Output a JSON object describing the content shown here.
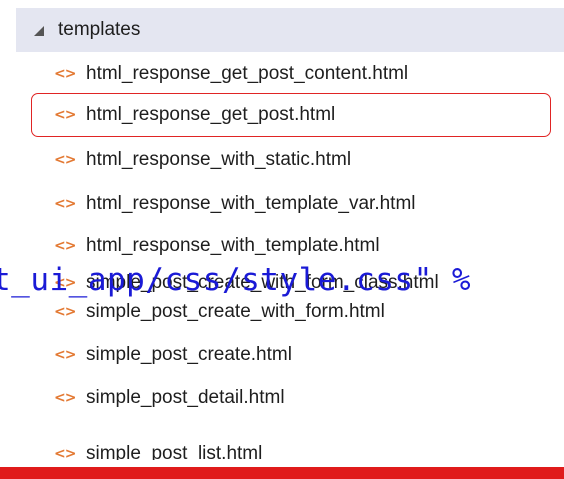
{
  "explorer": {
    "folder": {
      "label": "templates",
      "icon": "expanded-triangle-icon"
    },
    "file_icon_glyph": "<>",
    "files": [
      {
        "label": "html_response_get_post_content.html"
      },
      {
        "label": "html_response_get_post.html",
        "selected": true
      },
      {
        "label": "html_response_with_static.html"
      },
      {
        "label": "html_response_with_template_var.html"
      },
      {
        "label": "html_response_with_template.html"
      },
      {
        "label": "simple_post_create_with_form_class.html"
      },
      {
        "label": "simple_post_create_with_form.html"
      },
      {
        "label": "simple_post_create.html"
      },
      {
        "label": "simple_post_detail.html"
      },
      {
        "label": "simple_post_list.html"
      }
    ]
  },
  "overlay": {
    "code_text": "t_ui_app/css/style.css\" %"
  },
  "colors": {
    "folder_bg": "#e4e6f1",
    "file_icon": "#e37933",
    "highlight": "#e02424",
    "overlay_text": "#1a1ad6",
    "bottom_bar": "#e01b1b"
  }
}
